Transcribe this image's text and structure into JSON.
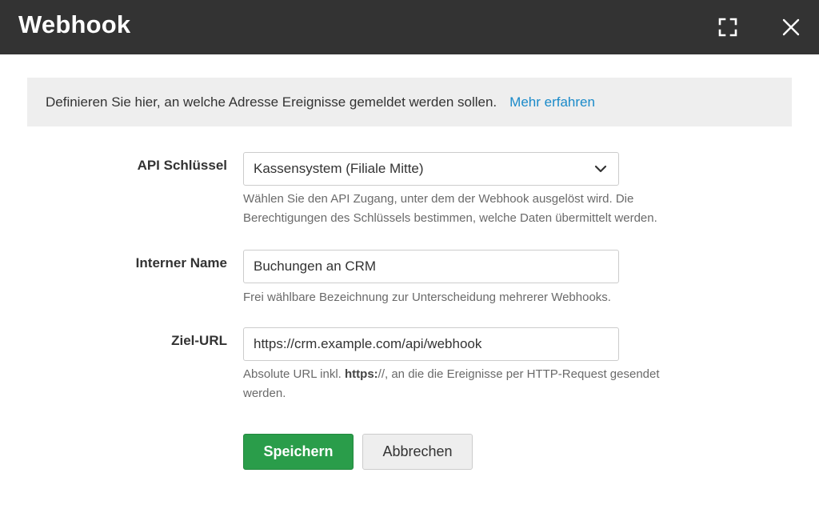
{
  "dialog": {
    "title": "Webhook",
    "icons": {
      "expand": "fullscreen-icon",
      "close": "close-icon"
    }
  },
  "info": {
    "text": "Definieren Sie hier, an welche Adresse Ereignisse gemeldet werden sollen.",
    "link": "Mehr erfahren"
  },
  "form": {
    "api_key": {
      "label": "API Schlüssel",
      "value": "Kassensystem (Filiale Mitte)",
      "help_line1": "Wählen Sie den API Zugang, unter dem der Webhook ausgelöst wird. Die",
      "help_line2": "Berechtigungen des Schlüssels bestimmen, welche Daten übermittelt werden."
    },
    "internal_name": {
      "label": "Interner Name",
      "value": "Buchungen an CRM",
      "help": "Frei wählbare Bezeichnung zur Unterscheidung mehrerer Webhooks."
    },
    "target_url": {
      "label": "Ziel-URL",
      "value": "https://crm.example.com/api/webhook",
      "help_prefix": "Absolute URL inkl. ",
      "help_bold": "https:",
      "help_suffix": "//, an die die Ereignisse per HTTP-Request gesendet",
      "help_line2": "werden."
    }
  },
  "buttons": {
    "save": "Speichern",
    "cancel": "Abbrechen"
  },
  "colors": {
    "header_bg": "#333333",
    "link": "#1a8ac9",
    "primary": "#2a9d4a"
  }
}
